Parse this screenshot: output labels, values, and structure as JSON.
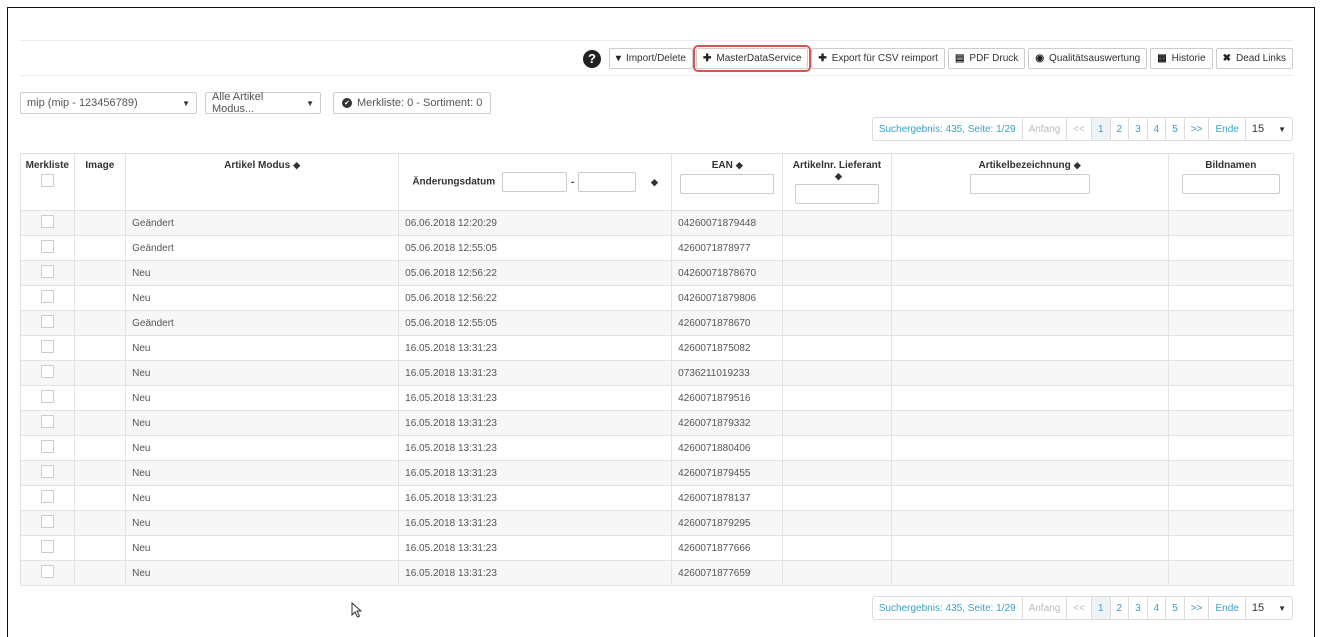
{
  "toolbar": {
    "help": "?",
    "buttons": [
      {
        "icon": "caret-down-icon",
        "label": "Import/Delete"
      },
      {
        "icon": "plus-icon",
        "label": "MasterDataService"
      },
      {
        "icon": "plus-icon",
        "label": "Export für CSV reimport"
      },
      {
        "icon": "print-icon",
        "label": "PDF Druck"
      },
      {
        "icon": "eye-icon",
        "label": "Qualitätsauswertung"
      },
      {
        "icon": "list-icon",
        "label": "Historie"
      },
      {
        "icon": "close-icon",
        "label": "Dead Links"
      }
    ]
  },
  "filters": {
    "supplier": "mip (mip - 123456789)",
    "mode": "Alle Artikel Modus...",
    "merkliste": "Merkliste: 0 - Sortiment: 0"
  },
  "pager": {
    "info": "Suchergebnis: 435, Seite: 1/29",
    "first": "Anfang",
    "prev": "<<",
    "pages": [
      "1",
      "2",
      "3",
      "4",
      "5"
    ],
    "next": ">>",
    "last": "Ende",
    "per_page": "15"
  },
  "table": {
    "headers": {
      "merkliste": "Merkliste",
      "image": "Image",
      "mode": "Artikel Modus",
      "date": "Änderungsdatum",
      "ean": "EAN",
      "supplier_no": "Artikelnr. Lieferant",
      "name": "Artikelbezeichnung",
      "images": "Bildnamen"
    },
    "rows": [
      {
        "mode": "Geändert",
        "date": "06.06.2018 12:20:29",
        "ean": "04260071879448"
      },
      {
        "mode": "Geändert",
        "date": "05.06.2018 12:55:05",
        "ean": "4260071878977"
      },
      {
        "mode": "Neu",
        "date": "05.06.2018 12:56:22",
        "ean": "04260071878670"
      },
      {
        "mode": "Neu",
        "date": "05.06.2018 12:56:22",
        "ean": "04260071879806"
      },
      {
        "mode": "Geändert",
        "date": "05.06.2018 12:55:05",
        "ean": "4260071878670"
      },
      {
        "mode": "Neu",
        "date": "16.05.2018 13:31:23",
        "ean": "4260071875082"
      },
      {
        "mode": "Neu",
        "date": "16.05.2018 13:31:23",
        "ean": "0736211019233"
      },
      {
        "mode": "Neu",
        "date": "16.05.2018 13:31:23",
        "ean": "4260071879516"
      },
      {
        "mode": "Neu",
        "date": "16.05.2018 13:31:23",
        "ean": "4260071879332"
      },
      {
        "mode": "Neu",
        "date": "16.05.2018 13:31:23",
        "ean": "4260071880406"
      },
      {
        "mode": "Neu",
        "date": "16.05.2018 13:31:23",
        "ean": "4260071879455"
      },
      {
        "mode": "Neu",
        "date": "16.05.2018 13:31:23",
        "ean": "4260071878137"
      },
      {
        "mode": "Neu",
        "date": "16.05.2018 13:31:23",
        "ean": "4260071879295"
      },
      {
        "mode": "Neu",
        "date": "16.05.2018 13:31:23",
        "ean": "4260071877666"
      },
      {
        "mode": "Neu",
        "date": "16.05.2018 13:31:23",
        "ean": "4260071877659"
      }
    ]
  },
  "colors": {
    "accent": "#3aa0c8",
    "highlight": "#d9534f"
  }
}
